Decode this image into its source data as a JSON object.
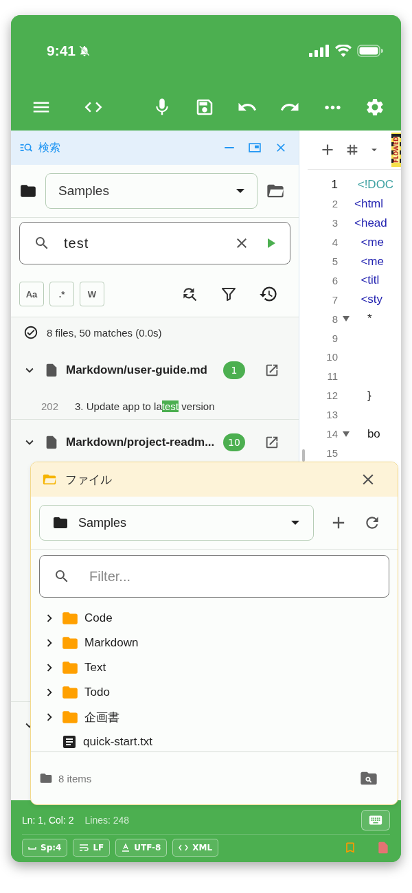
{
  "status_bar": {
    "time": "9:41",
    "silent": true
  },
  "toolbar": {
    "actions": [
      {
        "kind": "menu"
      },
      {
        "kind": "code"
      },
      {
        "kind": "mic"
      },
      {
        "kind": "save"
      },
      {
        "kind": "undo"
      },
      {
        "kind": "redo"
      },
      {
        "kind": "more"
      },
      {
        "kind": "settings"
      }
    ]
  },
  "search_panel": {
    "title": "検索",
    "folder": "Samples",
    "query": "test",
    "options": [
      {
        "label": "Aa",
        "selected": false
      },
      {
        "label": ".*",
        "selected": false
      },
      {
        "label": "W",
        "selected": false
      }
    ],
    "summary": "8 files, 50 matches (0.0s)",
    "results": [
      {
        "file": "Markdown/user-guide.md",
        "count": "1",
        "expanded": true,
        "matches": [
          {
            "line": "202",
            "before": "3. Update app to la",
            "match": "test",
            "after": " version"
          }
        ]
      },
      {
        "file": "Markdown/project-readm...",
        "count": "10",
        "expanded": true
      },
      {
        "expanded": true
      }
    ]
  },
  "editor": {
    "overflow_marker": "FLOWED",
    "lines": [
      {
        "number": "1",
        "code": " <!DOC",
        "kind": "doctype",
        "current": true,
        "foldable": false
      },
      {
        "number": "2",
        "code": "<html",
        "kind": "tag",
        "current": false,
        "foldable": false
      },
      {
        "number": "3",
        "code": "<head",
        "kind": "tag",
        "current": false,
        "foldable": false
      },
      {
        "number": "4",
        "code": "  <me",
        "kind": "tag",
        "current": false,
        "foldable": false
      },
      {
        "number": "5",
        "code": "  <me",
        "kind": "tag",
        "current": false,
        "foldable": false
      },
      {
        "number": "6",
        "code": "  <titl",
        "kind": "tag",
        "current": false,
        "foldable": false
      },
      {
        "number": "7",
        "code": "  <sty",
        "kind": "tag",
        "current": false,
        "foldable": false
      },
      {
        "number": "8",
        "code": "    *",
        "kind": "text",
        "current": false,
        "foldable": true
      },
      {
        "number": "9",
        "current": false,
        "foldable": false
      },
      {
        "number": "10",
        "current": false,
        "foldable": false
      },
      {
        "number": "11",
        "current": false,
        "foldable": false
      },
      {
        "number": "12",
        "code": "    }",
        "kind": "text",
        "current": false,
        "foldable": false
      },
      {
        "number": "13",
        "current": false,
        "foldable": false
      },
      {
        "number": "14",
        "code": "    bo",
        "kind": "text",
        "current": false,
        "foldable": true
      },
      {
        "number": "15",
        "current": false,
        "foldable": false
      }
    ]
  },
  "file_window": {
    "title": "ファイル",
    "folder": "Samples",
    "filter_placeholder": "Filter...",
    "items": [
      {
        "name": "Code",
        "kind": "folder",
        "expanded": false
      },
      {
        "name": "Markdown",
        "kind": "folder",
        "expanded": false
      },
      {
        "name": "Text",
        "kind": "folder",
        "expanded": false
      },
      {
        "name": "Todo",
        "kind": "folder",
        "expanded": false
      },
      {
        "name": "企画書",
        "kind": "folder",
        "expanded": false
      },
      {
        "name": "quick-start.txt",
        "kind": "file"
      }
    ],
    "count": "8 items"
  },
  "footer": {
    "position": "Ln: 1, Col: 2",
    "lines": "Lines: 248",
    "chips": [
      {
        "kind": "indent",
        "label": "Sp:4"
      },
      {
        "kind": "line_ending",
        "label": "LF"
      },
      {
        "kind": "encoding",
        "label": "UTF-8"
      },
      {
        "kind": "language",
        "label": "XML"
      }
    ]
  }
}
